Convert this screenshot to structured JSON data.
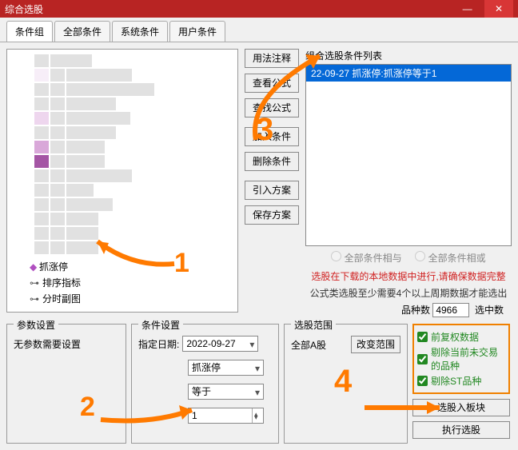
{
  "window": {
    "title": "综合选股",
    "close_glyph": "✕",
    "min_glyph": "—"
  },
  "tabs": [
    "条件组",
    "全部条件",
    "系统条件",
    "用户条件"
  ],
  "active_tab": 0,
  "tree": {
    "leaf1": "抓涨停",
    "leaf2": "排序指标",
    "leaf3": "分时副图"
  },
  "mid_buttons": {
    "usage": "用法注释",
    "view_formula": "查看公式",
    "find_formula": "查找公式",
    "add_cond": "加入条件",
    "del_cond": "删除条件",
    "import_plan": "引入方案",
    "save_plan": "保存方案"
  },
  "combo": {
    "label": "组合选股条件列表",
    "item": "22-09-27 抓涨停:抓涨停等于1",
    "radio_and": "全部条件相与",
    "radio_or": "全部条件相或",
    "red_msg": "选股在下载的本地数据中进行,请确保数据完整",
    "gray_msg": "公式类选股至少需要4个以上周期数据才能选出",
    "count_label_a": "品种数",
    "count_value": "4966",
    "count_label_b": "选中数"
  },
  "param_panel": {
    "title": "参数设置",
    "msg": "无参数需要设置"
  },
  "cond_panel": {
    "title": "条件设置",
    "date_label": "指定日期:",
    "date_value": "2022-09-27",
    "sel1": "抓涨停",
    "sel2": "等于",
    "num": "1"
  },
  "scope_panel": {
    "title": "选股范围",
    "scope": "全部A股",
    "change_btn": "改变范围"
  },
  "checks": {
    "c1": "前复权数据",
    "c2": "剔除当前未交易的品种",
    "c3": "剔除ST品种"
  },
  "right_buttons": {
    "add_block": "选股入板块",
    "run": "执行选股"
  },
  "steps": {
    "s1": "1",
    "s2": "2",
    "s3": "3",
    "s4": "4"
  }
}
